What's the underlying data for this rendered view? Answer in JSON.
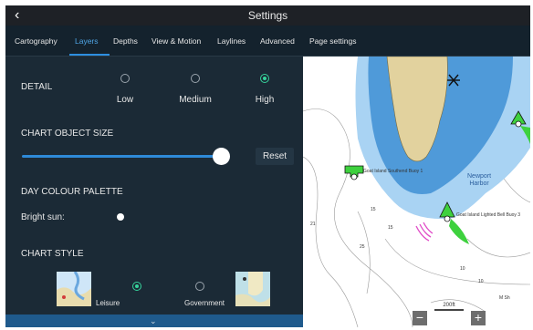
{
  "window": {
    "title": "Settings",
    "back_icon": "chevron-left-icon"
  },
  "tabs": [
    {
      "label": "Cartography",
      "active": false
    },
    {
      "label": "Layers",
      "active": true
    },
    {
      "label": "Depths",
      "active": false
    },
    {
      "label": "View & Motion",
      "active": false
    },
    {
      "label": "Laylines",
      "active": false
    },
    {
      "label": "Advanced",
      "active": false
    },
    {
      "label": "Page settings",
      "active": false
    }
  ],
  "settings": {
    "detail": {
      "label": "DETAIL",
      "options": [
        {
          "label": "Low",
          "selected": false
        },
        {
          "label": "Medium",
          "selected": false
        },
        {
          "label": "High",
          "selected": true
        }
      ]
    },
    "chart_object_size": {
      "label": "CHART OBJECT SIZE",
      "value_fraction": 0.95,
      "reset_label": "Reset"
    },
    "day_colour_palette": {
      "label": "DAY COLOUR PALETTE",
      "option_label": "Bright sun:"
    },
    "chart_style": {
      "label": "CHART STYLE",
      "options": [
        {
          "label": "Leisure",
          "selected": true
        },
        {
          "label": "Government",
          "selected": false
        }
      ]
    }
  },
  "chart": {
    "harbor_label": "Newport\nHarbor",
    "buoys": [
      {
        "label": "Goat Island\nSouthend Buoy 1"
      },
      {
        "label": "Goat Island Lighted\nBell Buoy 3"
      }
    ],
    "soundings": [
      "21",
      "15",
      "15",
      "25",
      "10",
      "10",
      "M Sh"
    ],
    "zoom_out_label": "−",
    "zoom_in_label": "+",
    "scale_label": "200ft"
  },
  "colors": {
    "accent": "#2d8fe0",
    "radio_selected": "#36d39b",
    "deep_water": "#4f9ad9",
    "shallow_water": "#a9d3f3",
    "land": "#e2d29e",
    "buoy_green": "#3ed13e"
  }
}
